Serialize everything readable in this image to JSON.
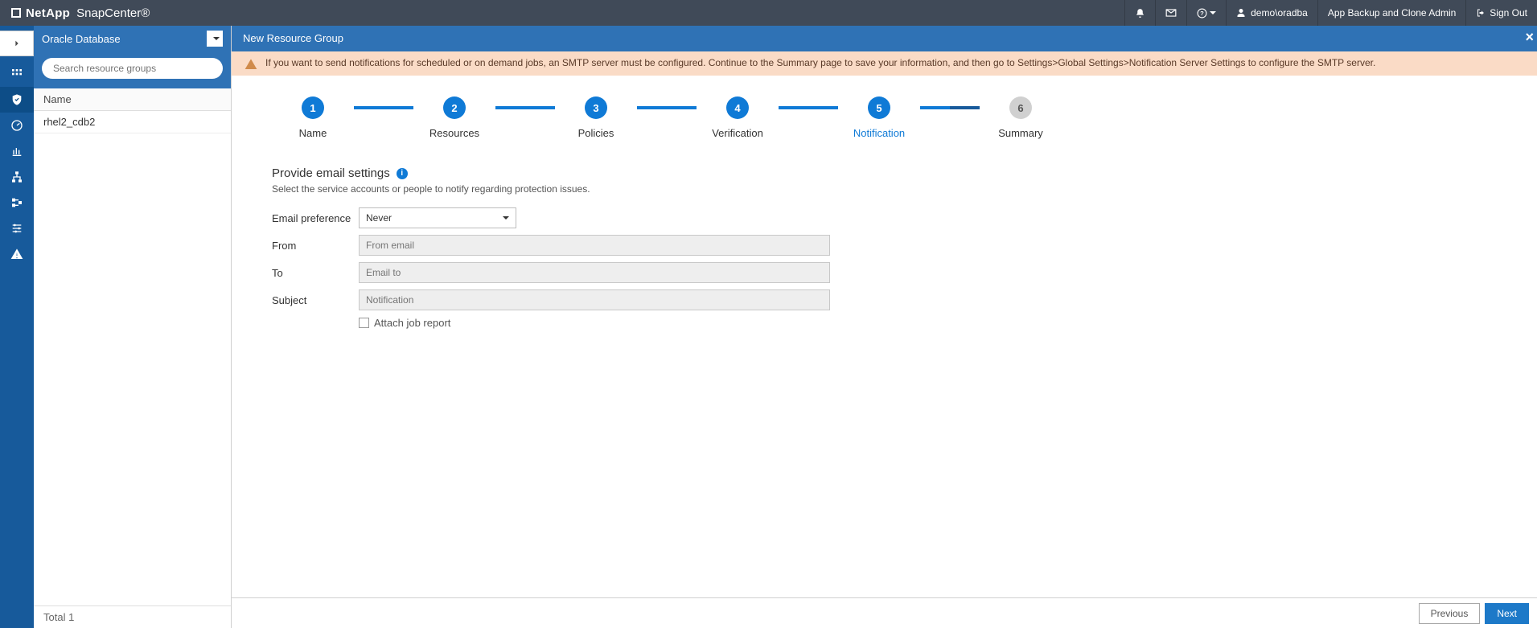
{
  "topbar": {
    "vendor": "NetApp",
    "product": "SnapCenter®",
    "user": "demo\\oradba",
    "role": "App Backup and Clone Admin",
    "signout": "Sign Out"
  },
  "sidebar": {
    "context": "Oracle Database",
    "search_placeholder": "Search resource groups",
    "col_name": "Name",
    "rows": [
      "rhel2_cdb2"
    ],
    "total": "Total 1"
  },
  "page": {
    "title": "New Resource Group",
    "alert": "If you want to send notifications for scheduled or on demand jobs, an SMTP server must be configured. Continue to the Summary page to save your information, and then go to Settings>Global Settings>Notification Server Settings to configure the SMTP server."
  },
  "steps": [
    {
      "n": "1",
      "label": "Name",
      "state": "done"
    },
    {
      "n": "2",
      "label": "Resources",
      "state": "done"
    },
    {
      "n": "3",
      "label": "Policies",
      "state": "done"
    },
    {
      "n": "4",
      "label": "Verification",
      "state": "done"
    },
    {
      "n": "5",
      "label": "Notification",
      "state": "active"
    },
    {
      "n": "6",
      "label": "Summary",
      "state": "future"
    }
  ],
  "section": {
    "title": "Provide email settings",
    "subtitle": "Select the service accounts or people to notify regarding protection issues."
  },
  "form": {
    "pref_label": "Email preference",
    "pref_value": "Never",
    "from_label": "From",
    "from_placeholder": "From email",
    "to_label": "To",
    "to_placeholder": "Email to",
    "subject_label": "Subject",
    "subject_placeholder": "Notification",
    "attach_label": "Attach job report"
  },
  "footer": {
    "prev": "Previous",
    "next": "Next"
  }
}
